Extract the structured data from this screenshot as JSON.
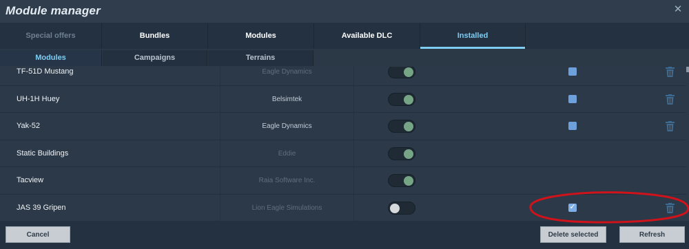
{
  "window": {
    "title": "Module manager",
    "close_icon": "close-icon"
  },
  "tabs": [
    {
      "label": "Special offers",
      "state": "disabled"
    },
    {
      "label": "Bundles",
      "state": "normal"
    },
    {
      "label": "Modules",
      "state": "normal"
    },
    {
      "label": "Available DLC",
      "state": "normal"
    },
    {
      "label": "Installed",
      "state": "active"
    }
  ],
  "subtabs": [
    {
      "label": "Modules",
      "state": "active"
    },
    {
      "label": "Campaigns",
      "state": "normal"
    },
    {
      "label": "Terrains",
      "state": "normal"
    }
  ],
  "modules": [
    {
      "name": "TF-51D Mustang",
      "vendor": "Eagle Dynamics",
      "vendor_dim": true,
      "enabled": true,
      "checkbox": "unchecked",
      "deletable": true
    },
    {
      "name": "UH-1H Huey",
      "vendor": "Belsimtek",
      "vendor_dim": false,
      "enabled": true,
      "checkbox": "unchecked",
      "deletable": true
    },
    {
      "name": "Yak-52",
      "vendor": "Eagle Dynamics",
      "vendor_dim": false,
      "enabled": true,
      "checkbox": "unchecked",
      "deletable": true
    },
    {
      "name": "Static Buildings",
      "vendor": "Eddie",
      "vendor_dim": true,
      "enabled": true,
      "checkbox": "none",
      "deletable": false
    },
    {
      "name": "Tacview",
      "vendor": "Raia Software Inc.",
      "vendor_dim": true,
      "enabled": true,
      "checkbox": "none",
      "deletable": false
    },
    {
      "name": "JAS 39 Gripen",
      "vendor": "Lion Eagle Simulations",
      "vendor_dim": true,
      "enabled": false,
      "checkbox": "checked",
      "deletable": true
    }
  ],
  "footer": {
    "cancel_label": "Cancel",
    "delete_label": "Delete selected",
    "refresh_label": "Refresh"
  },
  "colors": {
    "accent": "#7fcdf3",
    "toggle_on_knob": "#75a585",
    "checkbox": "#6ea0dc",
    "annotation_ellipse": "#d0121b"
  }
}
